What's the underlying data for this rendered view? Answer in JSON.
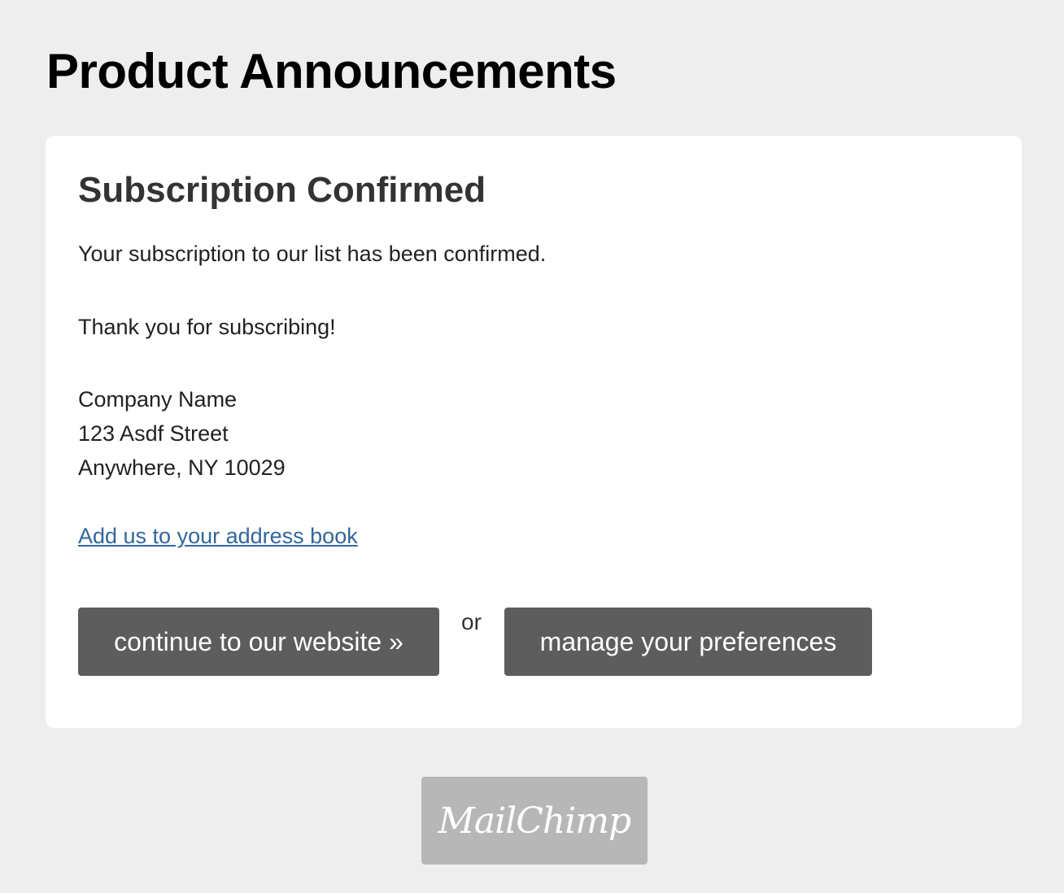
{
  "header": {
    "list_title": "Product Announcements"
  },
  "card": {
    "title": "Subscription Confirmed",
    "confirmation_text": "Your subscription to our list has been confirmed.",
    "thanks_text": "Thank you for subscribing!",
    "address": {
      "company": "Company Name",
      "street": "123 Asdf Street",
      "city_line": "Anywhere, NY 10029"
    },
    "address_book_link": "Add us to your address book",
    "actions": {
      "continue_label": "continue to our website »",
      "or_text": "or",
      "preferences_label": "manage your preferences"
    }
  },
  "footer": {
    "logo_text": "MailChimp"
  },
  "colors": {
    "page_background": "#eeeeee",
    "card_background": "#ffffff",
    "button_background": "#5d5d5d",
    "link": "#336699",
    "logo_background": "#b7b7b7"
  }
}
